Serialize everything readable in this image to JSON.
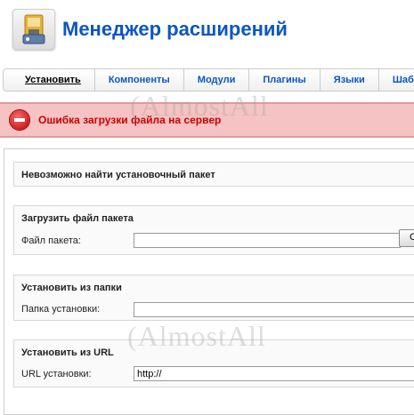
{
  "header": {
    "title": "Менеджер расширений",
    "icon": "extension-manager-icon"
  },
  "submenu": {
    "items": [
      {
        "label": "Установить",
        "active": true
      },
      {
        "label": "Компоненты"
      },
      {
        "label": "Модули"
      },
      {
        "label": "Плагины"
      },
      {
        "label": "Языки"
      },
      {
        "label": "Шаб"
      }
    ]
  },
  "message": {
    "type": "error",
    "text": "Ошибка загрузки файла на сервер",
    "color": "#cc0000",
    "icon": "error-minus-icon"
  },
  "notice": {
    "title": "Невозможно найти установочный пакет"
  },
  "upload": {
    "title": "Загрузить файл пакета",
    "label": "Файл пакета:",
    "value": "",
    "button_label": "О"
  },
  "from_folder": {
    "title": "Установить из папки",
    "label": "Папка установки:",
    "value": ""
  },
  "from_url": {
    "title": "Установить из URL",
    "label": "URL установки:",
    "value": "http://"
  },
  "watermark": {
    "text": "(AlmostAll"
  },
  "colors": {
    "accent": "#0b55c4",
    "error_bg": "#f5c3c3"
  }
}
